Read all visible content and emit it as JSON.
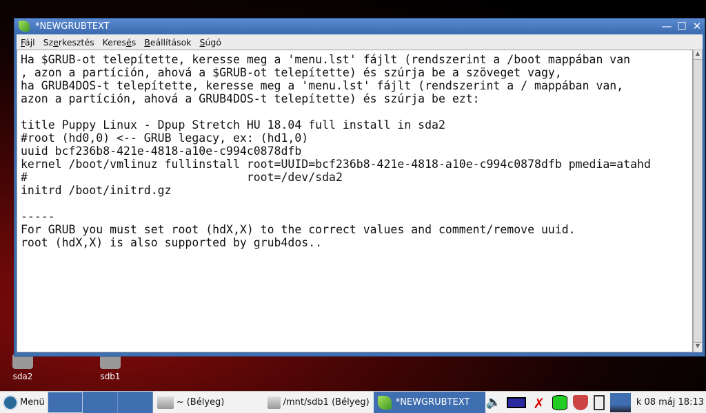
{
  "desktop": {
    "icons": [
      {
        "label": "sda2"
      },
      {
        "label": "sdb1"
      }
    ]
  },
  "window": {
    "title": "*NEWGRUBTEXT",
    "menu": [
      {
        "label": "Fájl",
        "mnemonic": "F",
        "rest": "ájl",
        "pre": ""
      },
      {
        "label": "Szerkesztés",
        "pre": "Sz",
        "mnemonic": "e",
        "rest": "rkesztés"
      },
      {
        "label": "Keresés",
        "pre": "Keres",
        "mnemonic": "é",
        "rest": "s"
      },
      {
        "label": "Beállítások",
        "pre": "",
        "mnemonic": "B",
        "rest": "eállítások"
      },
      {
        "label": "Súgó",
        "pre": "",
        "mnemonic": "S",
        "rest": "úgó"
      }
    ],
    "lines": [
      "Ha $GRUB-ot telepítette, keresse meg a 'menu.lst' fájlt (rendszerint a /boot mappában van",
      ", azon a partíción, ahová a $GRUB-ot telepítette) és szúrja be a szöveget vagy,",
      "ha GRUB4DOS-t telepítette, keresse meg a 'menu.lst' fájlt (rendszerint a / mappában van,",
      "azon a partíción, ahová a GRUB4DOS-t telepítette) és szúrja be ezt:",
      "",
      "title Puppy Linux - Dpup Stretch HU 18.04 full install in sda2",
      "#root (hd0,0) <-- GRUB legacy, ex: (hd1,0)",
      "uuid bcf236b8-421e-4818-a10e-c994c0878dfb",
      "kernel /boot/vmlinuz fullinstall root=UUID=bcf236b8-421e-4818-a10e-c994c0878dfb pmedia=atahd",
      "#                                root=/dev/sda2",
      "initrd /boot/initrd.gz",
      "",
      "-----",
      "For GRUB you must set root (hdX,X) to the correct values and comment/remove uuid.",
      "root (hdX,X) is also supported by grub4dos.."
    ]
  },
  "taskbar": {
    "menu_label": "Menü",
    "tasks": [
      {
        "label": "~ (Bélyeg)"
      },
      {
        "label": "/mnt/sdb1 (Bélyeg)"
      },
      {
        "label": "*NEWGRUBTEXT"
      }
    ],
    "clock": "k 08 máj 18:13"
  },
  "colors": {
    "accent": "#3f6fb0"
  }
}
